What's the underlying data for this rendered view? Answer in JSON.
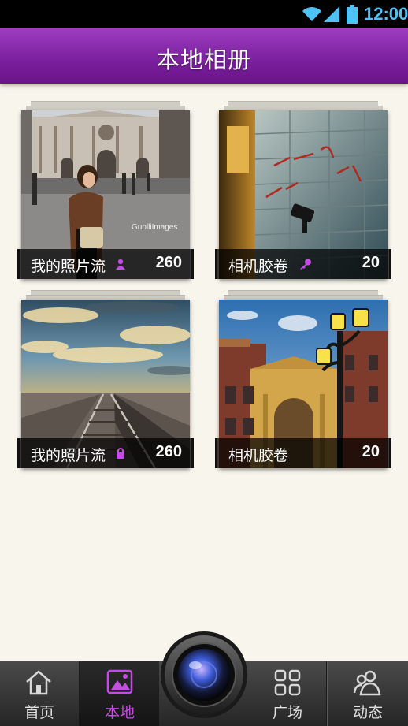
{
  "status_bar": {
    "time": "12:00",
    "icons": [
      "wifi-icon",
      "signal-icon",
      "battery-icon"
    ]
  },
  "header": {
    "title": "本地相册"
  },
  "albums": [
    {
      "name": "我的照片流",
      "count": "260",
      "badge_icon": "person-icon",
      "watermark": "GuolliImages"
    },
    {
      "name": "相机胶卷",
      "count": "20",
      "badge_icon": "key-icon"
    },
    {
      "name": "我的照片流",
      "count": "260",
      "badge_icon": "lock-icon"
    },
    {
      "name": "相机胶卷",
      "count": "20"
    }
  ],
  "bottom_nav": {
    "items": [
      {
        "label": "首页",
        "icon": "home-icon"
      },
      {
        "label": "本地",
        "icon": "image-icon",
        "active": true
      },
      {
        "label": "广场",
        "icon": "grid-icon"
      },
      {
        "label": "动态",
        "icon": "people-icon"
      }
    ],
    "camera": "camera-icon"
  },
  "colors": {
    "accent": "#8a2bb0",
    "active_tab": "#c24de0",
    "status_icons": "#4fc3f7"
  }
}
